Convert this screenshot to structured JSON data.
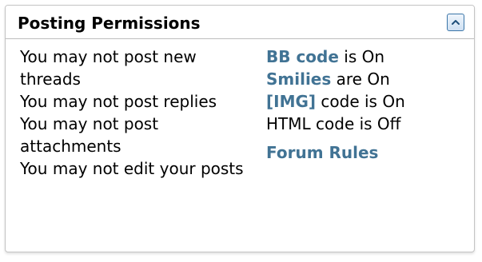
{
  "panel": {
    "title": "Posting Permissions",
    "collapse_icon": "chevron-up-icon",
    "accent_color": "#417394"
  },
  "permissions": [
    "You may not post new threads",
    "You may not post replies",
    "You may not post attachments",
    "You may not edit your posts"
  ],
  "codes": {
    "bb_code": {
      "link": "BB code",
      "status": "is On"
    },
    "smilies": {
      "link": "Smilies",
      "status": "are On"
    },
    "img_code": {
      "link": "[IMG]",
      "status": "code is On"
    },
    "html_code": {
      "text": "HTML code is Off"
    }
  },
  "forum_rules": "Forum Rules"
}
